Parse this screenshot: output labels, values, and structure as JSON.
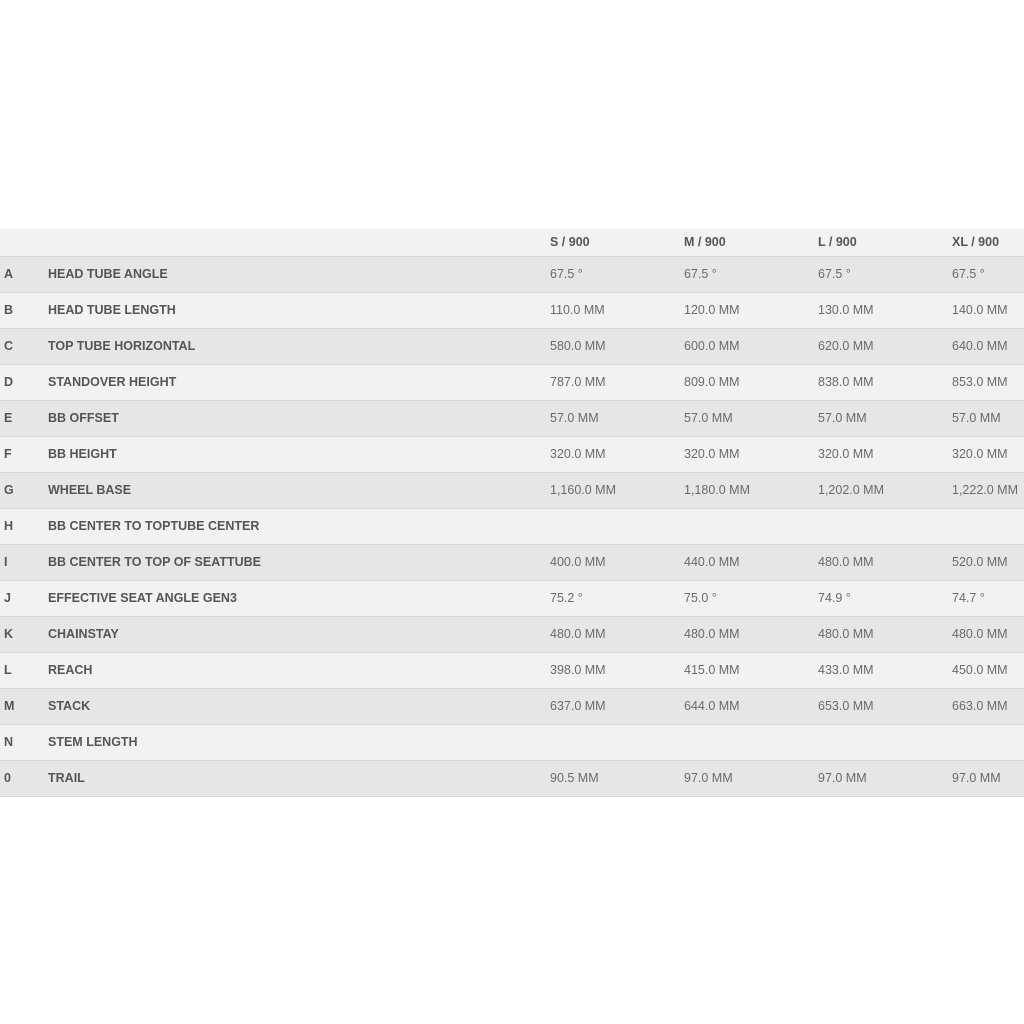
{
  "table": {
    "headers": [
      "S / 900",
      "M / 900",
      "L / 900",
      "XL / 900"
    ],
    "rows": [
      {
        "letter": "A",
        "label": "HEAD TUBE ANGLE",
        "values": [
          "67.5 °",
          "67.5 °",
          "67.5 °",
          "67.5 °"
        ]
      },
      {
        "letter": "B",
        "label": "HEAD TUBE LENGTH",
        "values": [
          "110.0 MM",
          "120.0 MM",
          "130.0 MM",
          "140.0 MM"
        ]
      },
      {
        "letter": "C",
        "label": "TOP TUBE HORIZONTAL",
        "values": [
          "580.0 MM",
          "600.0 MM",
          "620.0 MM",
          "640.0 MM"
        ]
      },
      {
        "letter": "D",
        "label": "STANDOVER HEIGHT",
        "values": [
          "787.0 MM",
          "809.0 MM",
          "838.0 MM",
          "853.0 MM"
        ]
      },
      {
        "letter": "E",
        "label": "BB OFFSET",
        "values": [
          "57.0 MM",
          "57.0 MM",
          "57.0 MM",
          "57.0 MM"
        ]
      },
      {
        "letter": "F",
        "label": "BB HEIGHT",
        "values": [
          "320.0 MM",
          "320.0 MM",
          "320.0 MM",
          "320.0 MM"
        ]
      },
      {
        "letter": "G",
        "label": "WHEEL BASE",
        "values": [
          "1,160.0 MM",
          "1,180.0 MM",
          "1,202.0 MM",
          "1,222.0 MM"
        ]
      },
      {
        "letter": "H",
        "label": "BB CENTER TO TOPTUBE CENTER",
        "values": [
          "",
          "",
          "",
          ""
        ]
      },
      {
        "letter": "I",
        "label": "BB CENTER TO TOP OF SEATTUBE",
        "values": [
          "400.0 MM",
          "440.0 MM",
          "480.0 MM",
          "520.0 MM"
        ]
      },
      {
        "letter": "J",
        "label": "EFFECTIVE SEAT ANGLE GEN3",
        "values": [
          "75.2 °",
          "75.0 °",
          "74.9 °",
          "74.7 °"
        ]
      },
      {
        "letter": "K",
        "label": "CHAINSTAY",
        "values": [
          "480.0 MM",
          "480.0 MM",
          "480.0 MM",
          "480.0 MM"
        ]
      },
      {
        "letter": "L",
        "label": "REACH",
        "values": [
          "398.0 MM",
          "415.0 MM",
          "433.0 MM",
          "450.0 MM"
        ]
      },
      {
        "letter": "M",
        "label": "STACK",
        "values": [
          "637.0 MM",
          "644.0 MM",
          "653.0 MM",
          "663.0 MM"
        ]
      },
      {
        "letter": "N",
        "label": "STEM LENGTH",
        "values": [
          "",
          "",
          "",
          ""
        ]
      },
      {
        "letter": "0",
        "label": "TRAIL",
        "values": [
          "90.5 MM",
          "97.0 MM",
          "97.0 MM",
          "97.0 MM"
        ]
      }
    ]
  }
}
